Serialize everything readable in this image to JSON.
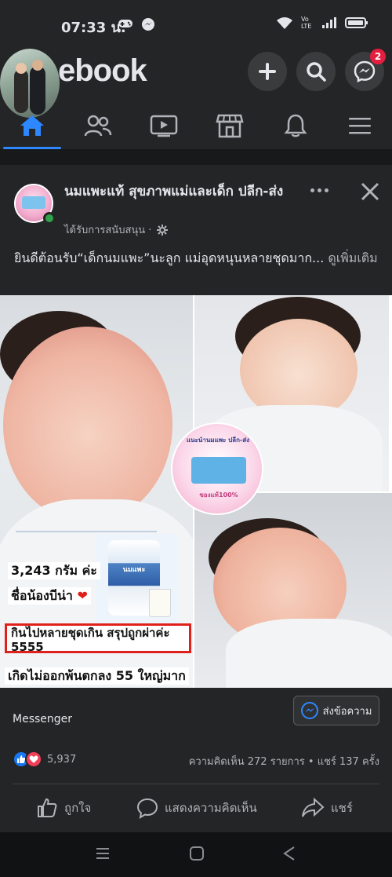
{
  "status_bar": {
    "time": "07:33 น.",
    "carrier_label": "Vo LTE"
  },
  "app": {
    "brand": "ebook",
    "messenger_badge": "2"
  },
  "nav": {
    "items": [
      "home-icon",
      "friends-icon",
      "watch-icon",
      "marketplace-icon",
      "notifications-icon",
      "menu-icon"
    ],
    "active": "home",
    "accent": "#2d88ff"
  },
  "post": {
    "page_name": "นมแพะแท้ สุขภาพแม่และเด็ก ปลีก-ส่ง",
    "sponsored": "ได้รับการสนับสนุน ·",
    "text": "ยินดีต้อนรับ“เด็กนมแพะ”นะลูก  แม่อุดหนุนหลายชุดมาก...",
    "see_more": " ดูเพิ่มเติม",
    "captions": {
      "weight": "3,243 กรัม ค่ะ",
      "name": "ชื่อน้องบีน่า",
      "line1": "กินไปหลายชุดเกิน สรุปถูกผ่าค่ะ",
      "line2": "5555",
      "line3": "เกิดไม่ออกพ้นตกลง 55 ใหญ่มาก"
    },
    "promo": {
      "top": "แนะนำนมแพะ ปลีก-ส่ง",
      "bottom": "ของแท้100%"
    },
    "product_label": "นมแพะ",
    "cta_label": "Messenger",
    "cta_button": "ส่งข้อความ",
    "reaction_count": "5,937",
    "stats": "ความคิดเห็น 272 รายการ • แชร์ 137 ครั้ง",
    "actions": {
      "like": "ถูกใจ",
      "comment": "แสดงความคิดเห็น",
      "share": "แชร์"
    }
  }
}
